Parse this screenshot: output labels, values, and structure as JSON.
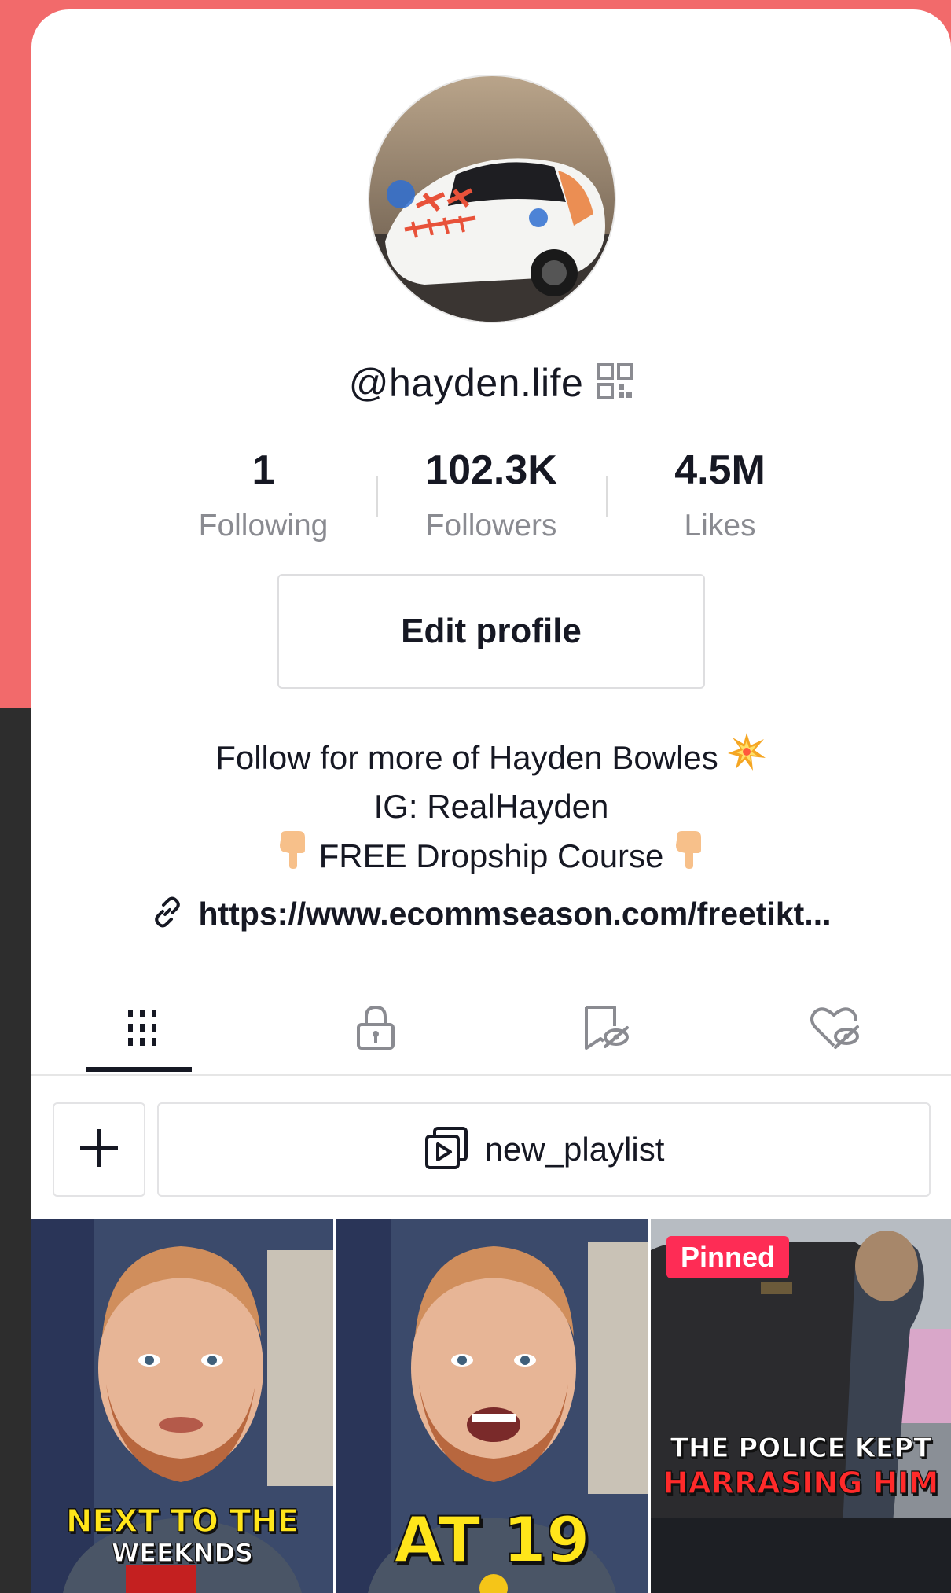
{
  "profile": {
    "username": "@hayden.life",
    "stats": [
      {
        "value": "1",
        "label": "Following"
      },
      {
        "value": "102.3K",
        "label": "Followers"
      },
      {
        "value": "4.5M",
        "label": "Likes"
      }
    ],
    "edit_button": "Edit profile",
    "bio": {
      "line1": "Follow for more of Hayden Bowles",
      "line2": "IG: RealHayden",
      "line3": "FREE Dropship Course"
    },
    "link": "https://www.ecommseason.com/freetikt..."
  },
  "tabs": [
    {
      "icon": "videos-grid-icon",
      "active": true
    },
    {
      "icon": "lock-icon",
      "active": false
    },
    {
      "icon": "bookmark-hidden-icon",
      "active": false
    },
    {
      "icon": "heart-hidden-icon",
      "active": false
    }
  ],
  "playlist": {
    "add_icon": "plus-icon",
    "label": "new_playlist"
  },
  "videos": [
    {
      "caption_line1": "NEXT TO THE",
      "caption_line2": "WEEKNDS"
    },
    {
      "caption_line1": "AT 19"
    },
    {
      "badge": "Pinned",
      "caption_line1": "THE POLICE KEPT",
      "caption_line2": "HARRASING HIM"
    }
  ],
  "colors": {
    "background_top": "#f26a6b",
    "background_bottom": "#2d2d2d",
    "text_primary": "#161823",
    "text_secondary": "#8a8b91",
    "pinned_badge": "#fe2c55",
    "caption_yellow": "#ffe51a",
    "caption_red": "#ff2a2a"
  }
}
